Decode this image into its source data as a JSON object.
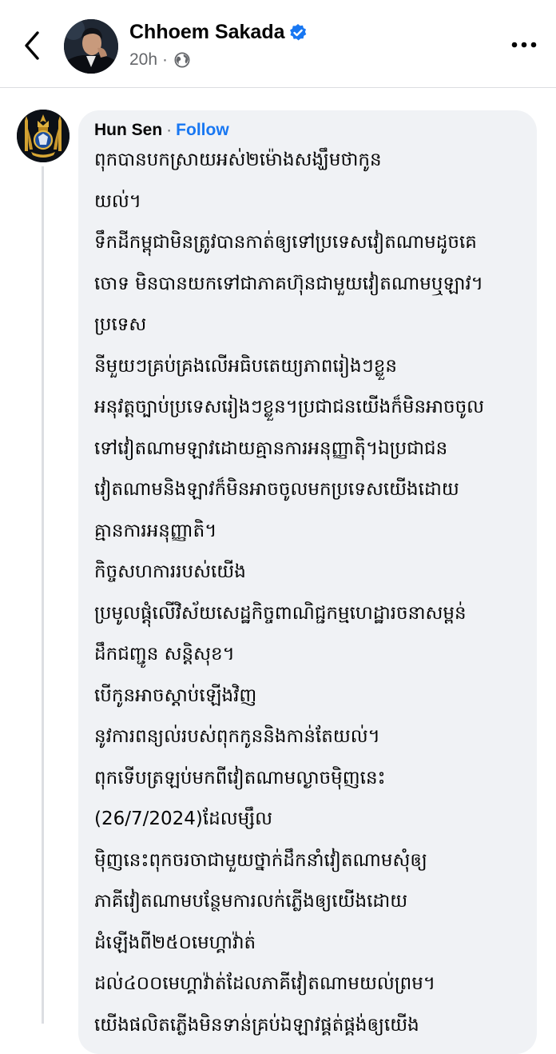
{
  "header": {
    "author_name": "Chhoem Sakada",
    "verified_icon": "verified-badge-icon",
    "time": "20h",
    "separator": "·",
    "audience_icon": "globe-icon",
    "back_icon": "chevron-left-icon",
    "more_icon": "more-horizontal-icon"
  },
  "comment": {
    "author": "Hun Sen",
    "separator": "·",
    "follow_label": "Follow",
    "lines": [
      "ពុកបានបកស្រាយអស់២ម៉ោងសង្ឃឹមថាកូន",
      "យល់។",
      "ទឹកដីកម្ពុជាមិនត្រូវបានកាត់ឲ្យទៅប្រទេសវៀតណាមដូចគេ",
      "ចោទ មិនបានយកទៅជាភាគហ៊ុនជាមួយវៀតណាមឬឡាវ។",
      "ប្រទេស",
      "នីមួយៗគ្រប់គ្រងលើអធិបតេយ្យភាពរៀងៗខ្លួន",
      "អនុវត្តច្បាប់ប្រទេសរៀងៗខ្លួន។ប្រជាជនយើងក៏មិនអាចចូល",
      "ទៅវៀតណាមឡាវដោយគ្មានការអនុញ្ញាត៉ិ។ឯប្រជាជន",
      "វៀតណាមនិងឡាវក៏មិនអាចចូលមកប្រទេសយើងដោយ",
      "គ្មានការអនុញ្ញាតិ។",
      "កិច្ចសហការរបស់យើង",
      "ប្រមូលផ្តុំលើវិស័យសេដ្ឋកិច្ចពាណិជ្ជកម្មហេដ្ឋារចនាសម្ពន់",
      "ដឹកជញ្ជូន សន្តិសុខ។",
      "បើកូនអាចស្តាប់ឡើងវិញ",
      "នូវការពន្យល់របស់ពុកកូននិងកាន់តែយល់។",
      "ពុកទើបត្រឡប់មកពីវៀតណាមល្ងាចម៉ិញនេះ",
      "(26/7/2024)ដែលម្សឹល",
      "ម៉ិញនេះពុកចរចាជាមួយថ្នាក់ដឹកនាំវៀតណាមសុំឲ្យ",
      "ភាគីវៀតណាមបន្ថែមការលក់ភ្លើងឲ្យយើងដោយ",
      "ដំឡើងពី២៥០មេហ្គាវ៉ាត់",
      "ដល់៤០០មេហ្គាវ៉ាត់ដែលភាគីវៀតណាមយល់ព្រម។",
      "យើងផលិតភ្លើងមិនទាន់គ្រប់ឯឡាវផ្គត់ផ្គង់ឲ្យយើង"
    ]
  }
}
